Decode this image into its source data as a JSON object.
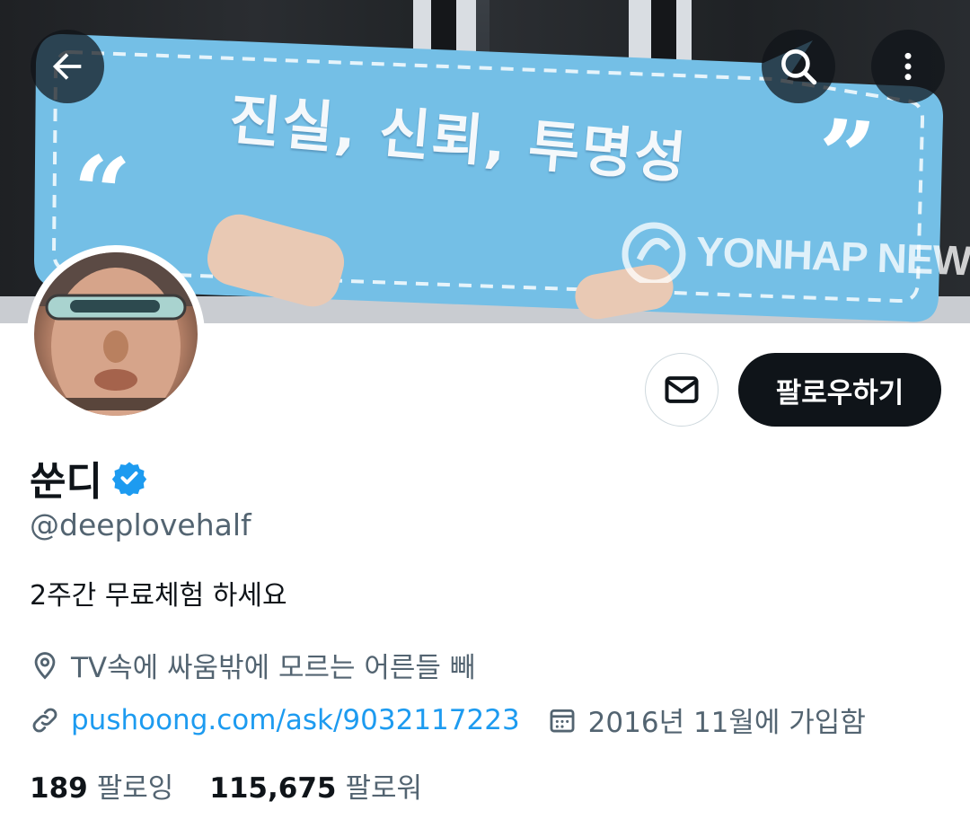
{
  "banner": {
    "sign_text": "진실, 신뢰, 투명성",
    "watermark": "YONHAP NEW",
    "sign_color": "#6fbfe8"
  },
  "header": {
    "back_icon": "arrow-left-icon",
    "search_icon": "search-icon",
    "more_icon": "more-vertical-icon"
  },
  "actions": {
    "message_icon": "mail-icon",
    "follow_label": "팔로우하기"
  },
  "profile": {
    "name": "쑨디",
    "verified": true,
    "handle": "@deeplovehalf",
    "bio": "2주간 무료체험 하세요",
    "location": "TV속에 싸움밖에 모르는 어른들 빼",
    "website": "pushoong.com/ask/9032117223",
    "joined": "2016년 11월에 가입함"
  },
  "stats": {
    "following_count": "189",
    "following_label": "팔로잉",
    "followers_count": "115,675",
    "followers_label": "팔로워"
  },
  "colors": {
    "accent": "#1d9bf0",
    "text_primary": "#0f1419",
    "text_secondary": "#536471"
  }
}
